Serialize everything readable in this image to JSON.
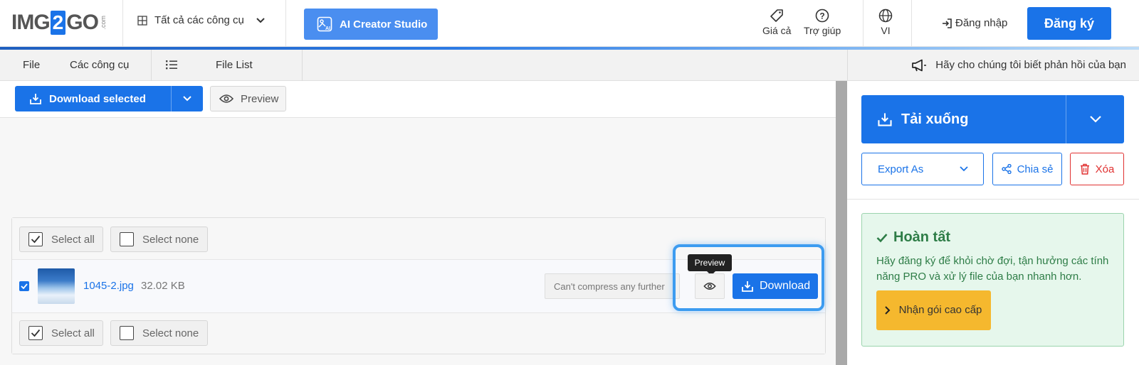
{
  "header": {
    "logo": {
      "img": "IMG",
      "two": "2",
      "go": "GO",
      "com": ".com"
    },
    "tools_dropdown": "Tất cả các công cụ",
    "ai_studio": "AI Creator Studio",
    "pricing": "Giá cả",
    "help": "Trợ giúp",
    "language": "VI",
    "login": "Đăng nhập",
    "signup": "Đăng ký"
  },
  "subbar": {
    "file": "File",
    "tools": "Các công cụ",
    "file_list": "File List",
    "feedback": "Hãy cho chúng tôi biết phản hồi của bạn"
  },
  "toolbar": {
    "download_selected": "Download selected",
    "preview": "Preview"
  },
  "files": {
    "select_all": "Select all",
    "select_none": "Select none",
    "items": [
      {
        "name": "1045-2.jpg",
        "size": "32.02 KB",
        "status": "Can't compress any further",
        "tooltip": "Preview",
        "download": "Download"
      }
    ]
  },
  "right": {
    "download": "Tải xuống",
    "export_as": "Export As",
    "share": "Chia sẻ",
    "delete": "Xóa",
    "done_title": "Hoàn tất",
    "done_text": "Hãy đăng ký để khỏi chờ đợi, tận hưởng các tính năng PRO và xử lý file của bạn nhanh hơn.",
    "premium": "Nhận gói cao cấp"
  },
  "colors": {
    "primary": "#1a73e8",
    "danger": "#e03131",
    "success_bg": "#e6f7ec",
    "success_text": "#2e7d47",
    "premium": "#f5b82e",
    "highlight": "#3d9cf0"
  },
  "icons": [
    "grid-icon",
    "chevron-down-icon",
    "ai-image-icon",
    "tag-icon",
    "question-icon",
    "globe-icon",
    "login-arrow-icon",
    "list-icon",
    "megaphone-icon",
    "download-tray-icon",
    "eye-icon",
    "check-icon",
    "share-icon",
    "trash-icon",
    "chevron-right-icon"
  ]
}
